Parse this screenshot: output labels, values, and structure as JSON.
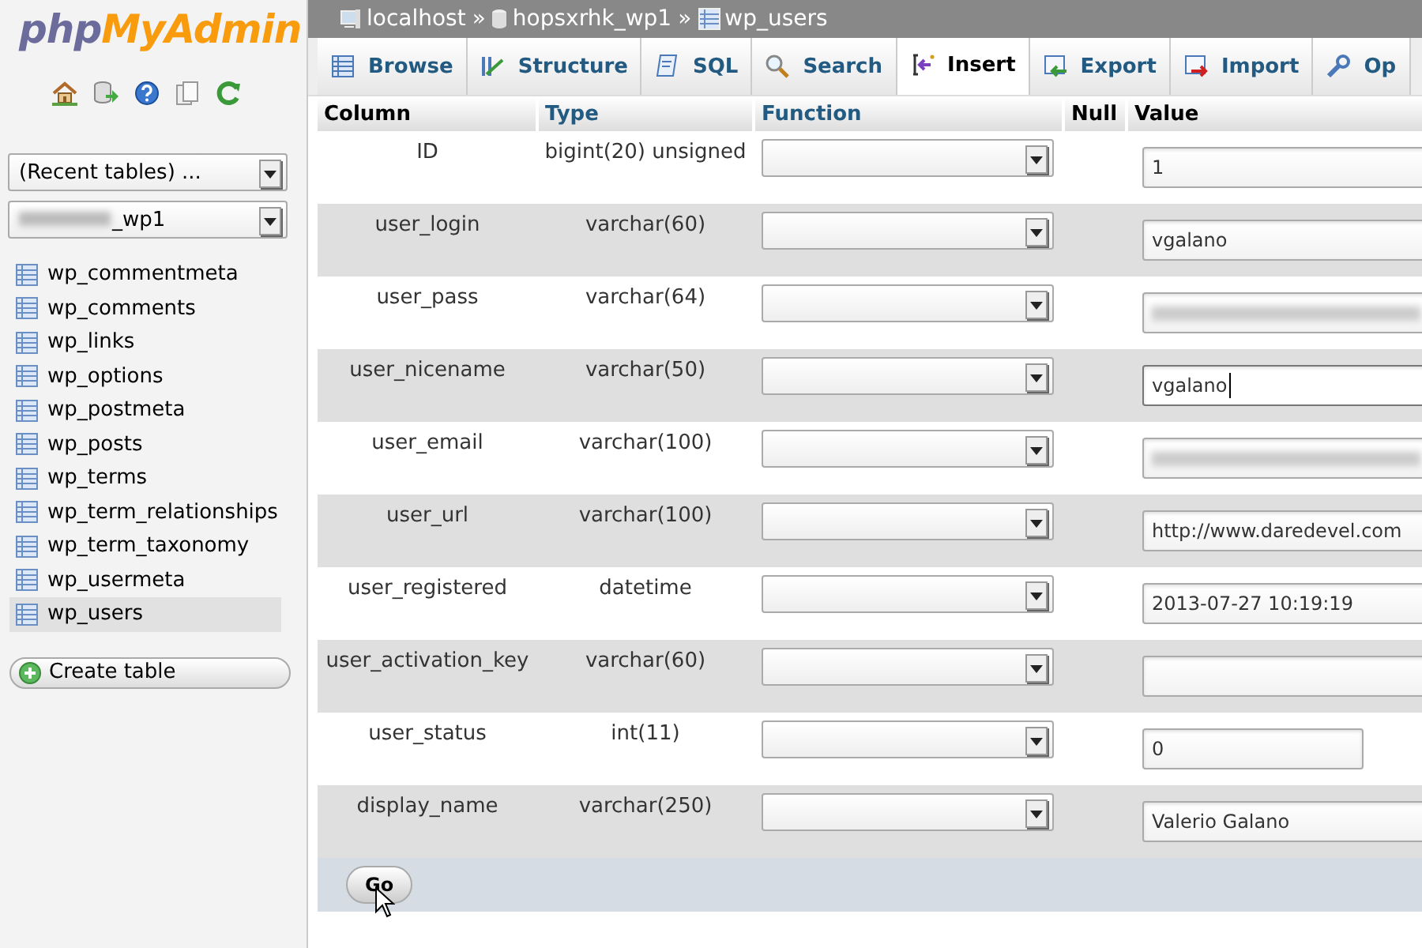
{
  "logo": {
    "part_1": "php",
    "part_2": "MyAdmin"
  },
  "sidebar": {
    "recent_tables": {
      "value": "(Recent tables) ..."
    },
    "database_select": {
      "value": "_wp1",
      "blurred_prefix": true
    },
    "tables": [
      {
        "label": "wp_commentmeta",
        "selected": false
      },
      {
        "label": "wp_comments",
        "selected": false
      },
      {
        "label": "wp_links",
        "selected": false
      },
      {
        "label": "wp_options",
        "selected": false
      },
      {
        "label": "wp_postmeta",
        "selected": false
      },
      {
        "label": "wp_posts",
        "selected": false
      },
      {
        "label": "wp_terms",
        "selected": false
      },
      {
        "label": "wp_term_relationships",
        "selected": false
      },
      {
        "label": "wp_term_taxonomy",
        "selected": false
      },
      {
        "label": "wp_usermeta",
        "selected": false
      },
      {
        "label": "wp_users",
        "selected": true
      }
    ],
    "create_table": "Create table"
  },
  "breadcrumb": [
    {
      "kind": "server",
      "label": "localhost"
    },
    {
      "kind": "database",
      "label": "hopsxrhk_wp1"
    },
    {
      "kind": "table",
      "label": "wp_users"
    }
  ],
  "breadcrumb_separator": "»",
  "tabs": [
    {
      "kind": "browse",
      "label": "Browse",
      "selected": false
    },
    {
      "kind": "structure",
      "label": "Structure",
      "selected": false
    },
    {
      "kind": "sql",
      "label": "SQL",
      "selected": false
    },
    {
      "kind": "search",
      "label": "Search",
      "selected": false
    },
    {
      "kind": "insert",
      "label": "Insert",
      "selected": true
    },
    {
      "kind": "export",
      "label": "Export",
      "selected": false
    },
    {
      "kind": "import",
      "label": "Import",
      "selected": false
    },
    {
      "kind": "operations",
      "label": "Op",
      "selected": false
    }
  ],
  "table": {
    "columns": [
      "Column",
      "Type",
      "Function",
      "Null",
      "Value"
    ],
    "rows": [
      {
        "column": "ID",
        "type": "bigint(20) unsigned",
        "value": "1",
        "blurred": false,
        "focused": false,
        "short": false
      },
      {
        "column": "user_login",
        "type": "varchar(60)",
        "value": "vgalano",
        "blurred": false,
        "focused": false,
        "short": false
      },
      {
        "column": "user_pass",
        "type": "varchar(64)",
        "blurred": true,
        "focused": false,
        "short": false
      },
      {
        "column": "user_nicename",
        "type": "varchar(50)",
        "value": "vgalano",
        "blurred": false,
        "focused": true,
        "short": false
      },
      {
        "column": "user_email",
        "type": "varchar(100)",
        "blurred": true,
        "focused": false,
        "short": false
      },
      {
        "column": "user_url",
        "type": "varchar(100)",
        "value": "http://www.daredevel.com",
        "blurred": false,
        "focused": false,
        "short": false
      },
      {
        "column": "user_registered",
        "type": "datetime",
        "value": "2013-07-27 10:19:19",
        "blurred": false,
        "focused": false,
        "short": false
      },
      {
        "column": "user_activation_key",
        "type": "varchar(60)",
        "blurred": false,
        "focused": false,
        "short": false
      },
      {
        "column": "user_status",
        "type": "int(11)",
        "value": "0",
        "blurred": false,
        "focused": false,
        "short": true
      },
      {
        "column": "display_name",
        "type": "varchar(250)",
        "value": "Valerio Galano",
        "blurred": false,
        "focused": false,
        "short": false
      }
    ]
  },
  "go_button": "Go"
}
